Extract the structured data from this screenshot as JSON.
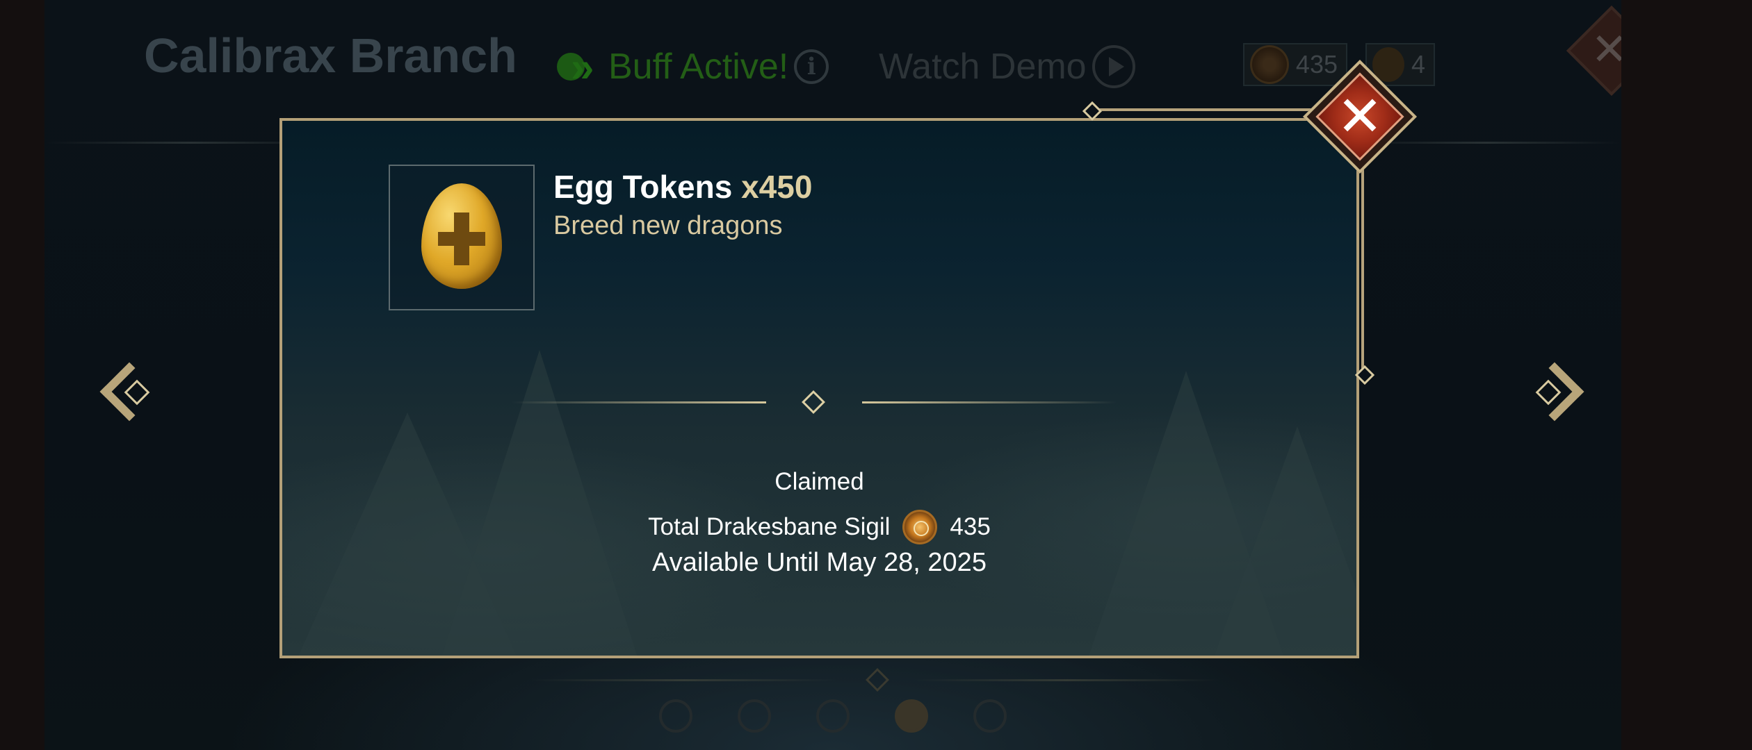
{
  "background": {
    "title": "Calibrax Branch",
    "buff_label": "Buff Active!",
    "watch_demo_label": "Watch Demo",
    "currency_sigil": "435",
    "currency_tokens": "4",
    "icons": [
      "buff-icon",
      "info-icon",
      "play-icon",
      "sigil-icon",
      "token-icon",
      "close-icon",
      "nav-left-icon",
      "nav-right-icon"
    ]
  },
  "pagination": {
    "total": 5,
    "active_index": 3
  },
  "dialog": {
    "item_name": "Egg Tokens",
    "item_quantity": "x450",
    "item_description": "Breed new dragons",
    "item_icon": "egg-token-icon",
    "status": "Claimed",
    "total_label": "Total Drakesbane Sigil",
    "total_value": "435",
    "availability": "Available Until May 28, 2025",
    "close_icon": "close-icon"
  },
  "colors": {
    "accent_gold": "#b4a078",
    "buff_green": "#235e16",
    "close_red": "#a02c18",
    "description_gold": "#d9c9a0"
  }
}
